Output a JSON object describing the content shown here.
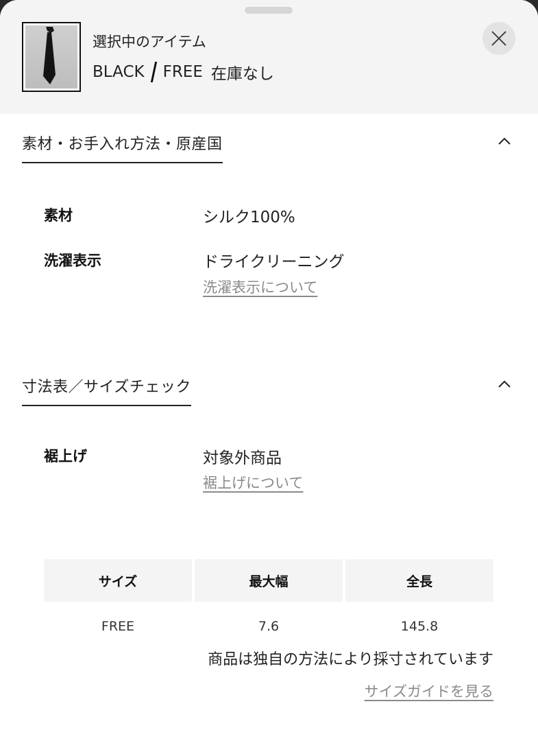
{
  "header": {
    "title": "選択中のアイテム",
    "color": "BLACK",
    "size": "FREE",
    "stock": "在庫なし"
  },
  "sections": {
    "material": {
      "title": "素材・お手入れ方法・原産国",
      "rows": [
        {
          "label": "素材",
          "value": "シルク100%"
        },
        {
          "label": "洗濯表示",
          "value": "ドライクリーニング",
          "link": "洗濯表示について"
        }
      ]
    },
    "size": {
      "title": "寸法表／サイズチェック",
      "hem_label": "裾上げ",
      "hem_value": "対象外商品",
      "hem_link": "裾上げについて",
      "table": {
        "headers": [
          "サイズ",
          "最大幅",
          "全長"
        ],
        "rows": [
          [
            "FREE",
            "7.6",
            "145.8"
          ]
        ]
      },
      "note": "商品は独自の方法により採寸されています",
      "guide_link": "サイズガイドを見る"
    }
  },
  "icons": {
    "close": "close-icon",
    "chevron": "chevron-up-icon"
  }
}
